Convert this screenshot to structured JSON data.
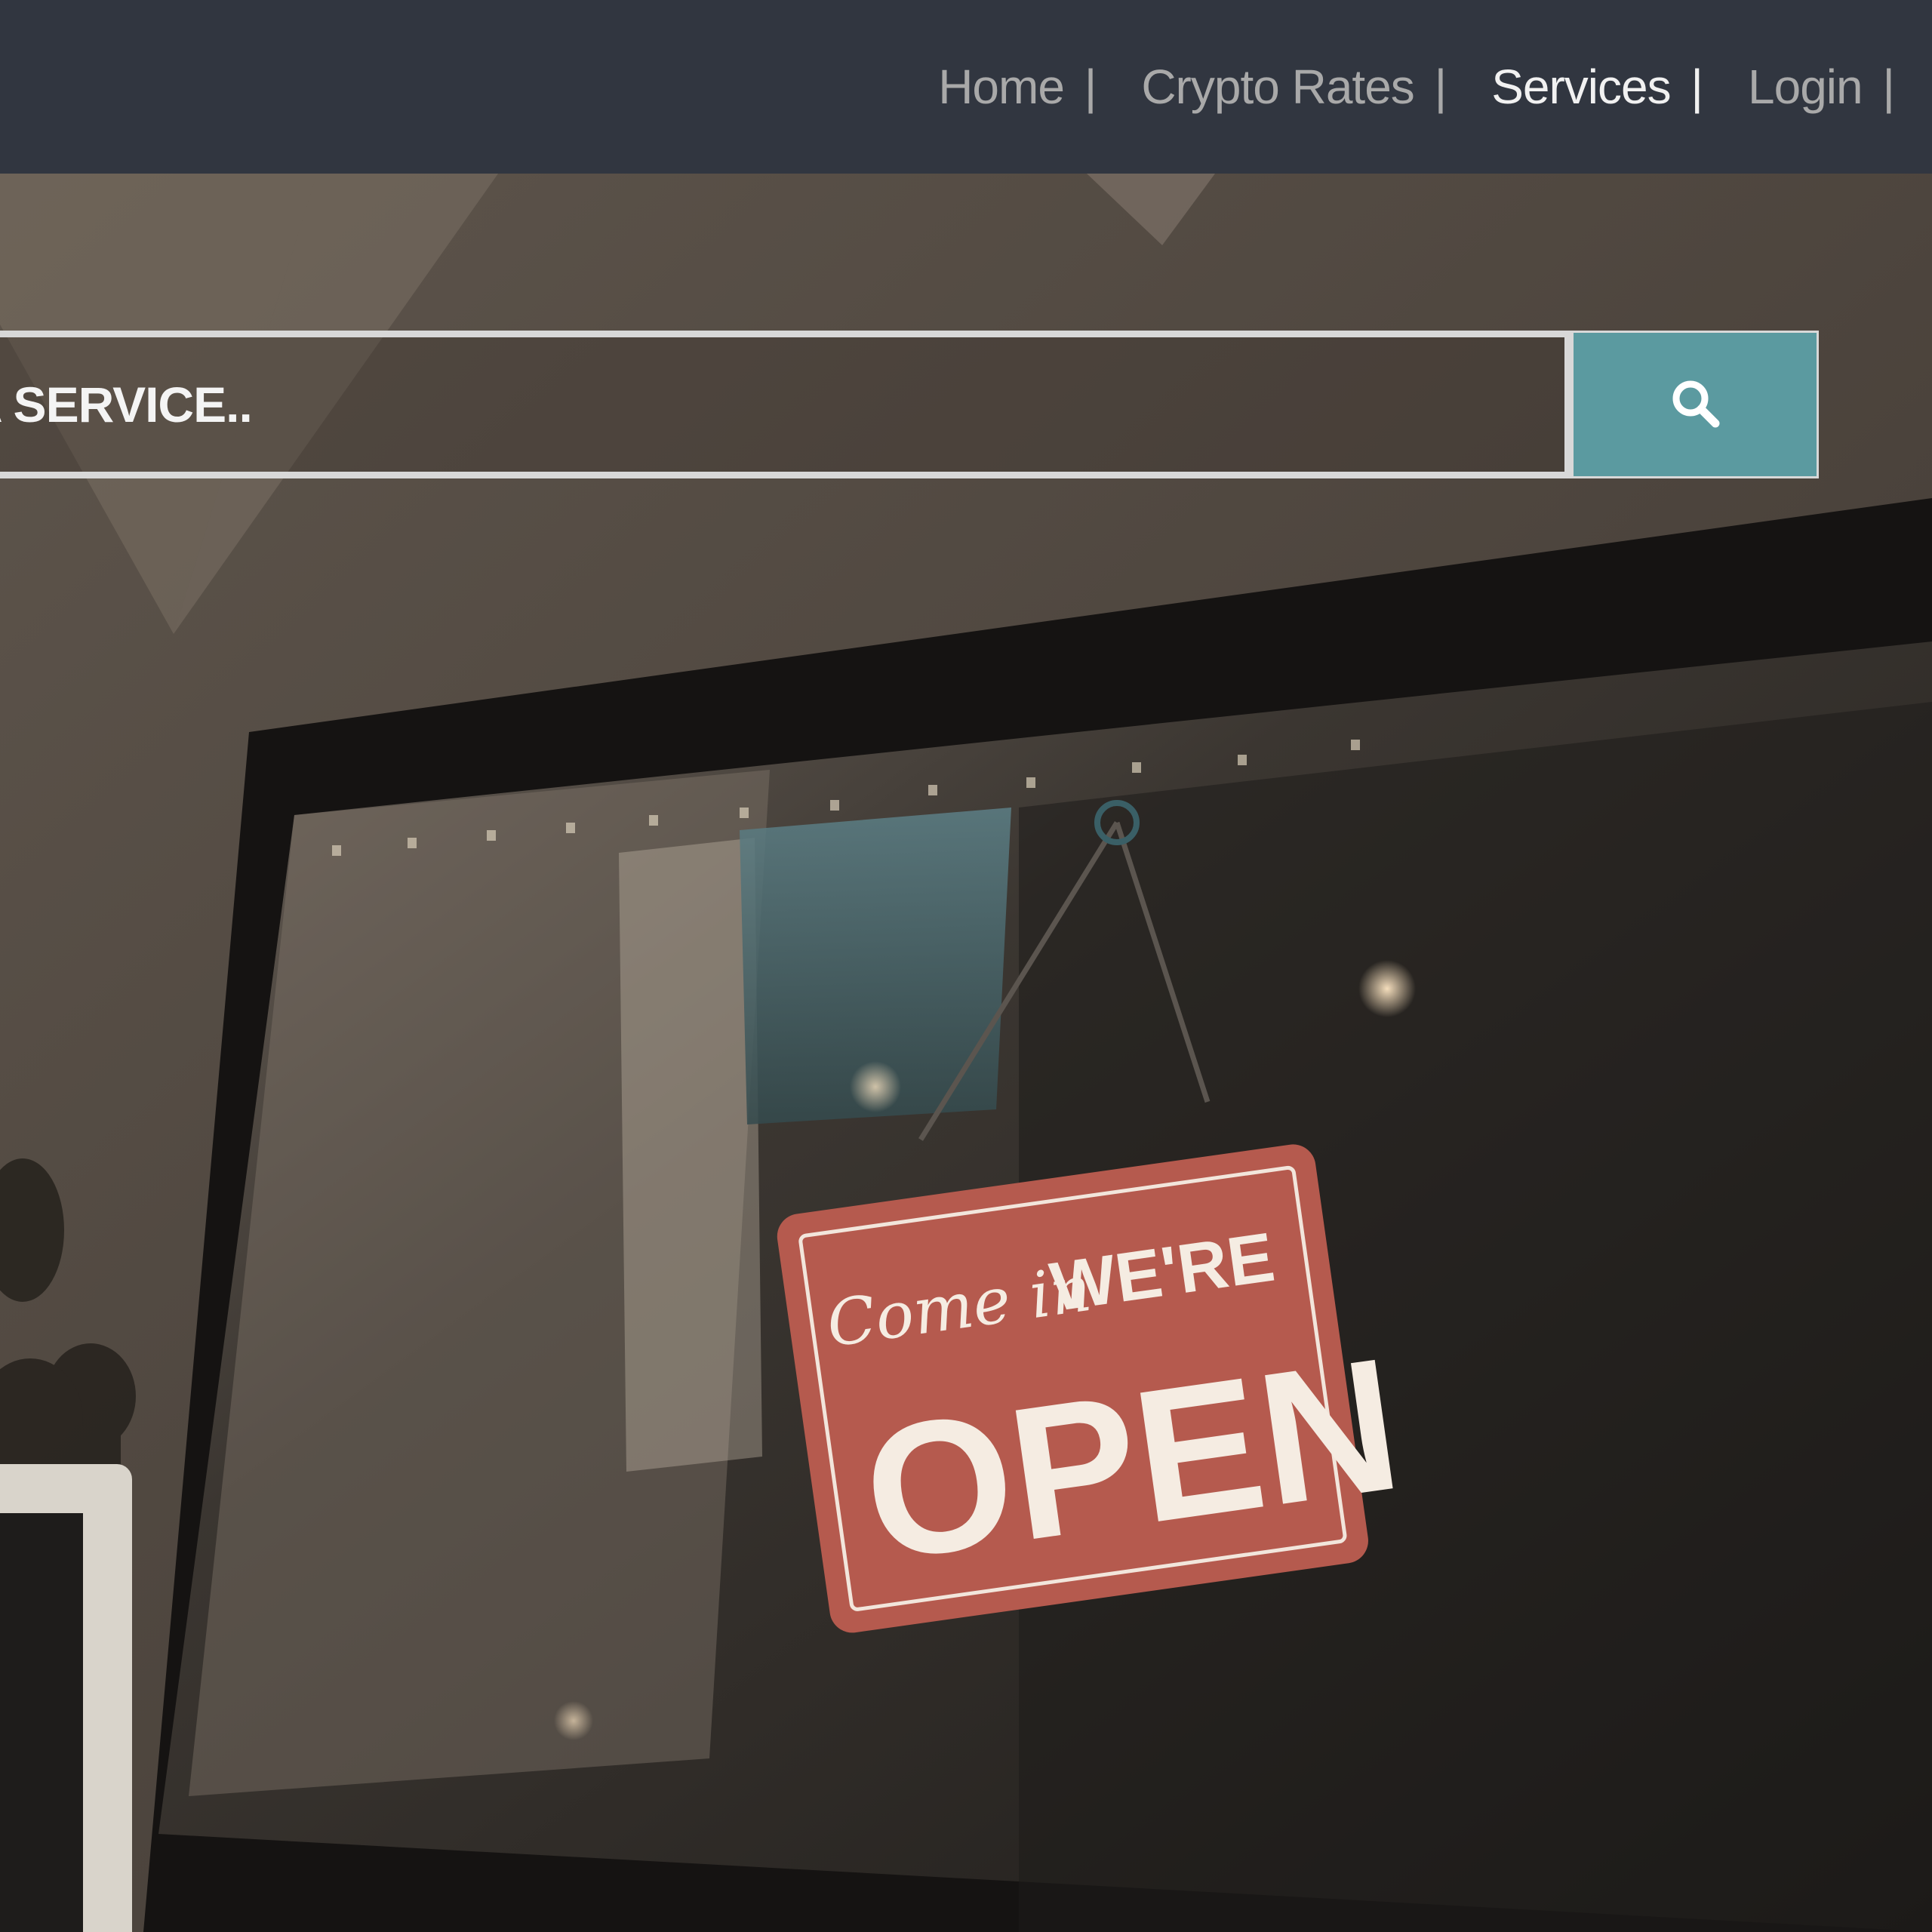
{
  "nav": {
    "items": [
      {
        "label": "Home",
        "sep": "|",
        "active": false
      },
      {
        "label": "Crypto Rates",
        "sep": "|",
        "active": false
      },
      {
        "label": "Services",
        "sep": "|",
        "active": true
      },
      {
        "label": "Login",
        "sep": "|",
        "active": false
      }
    ]
  },
  "search": {
    "placeholder": "A SERVICE.."
  },
  "hero": {
    "sign": {
      "script_text": "Come in",
      "headline": "WE'RE",
      "big_text": "OPEN"
    }
  },
  "colors": {
    "topbar": "#313640",
    "search_button": "#5b9aa0",
    "nav_text": "#a9a9a9",
    "nav_active": "#f1f1f1",
    "sign_red": "#b55a4e"
  },
  "icons": {
    "search_button_icon": "search-icon"
  }
}
